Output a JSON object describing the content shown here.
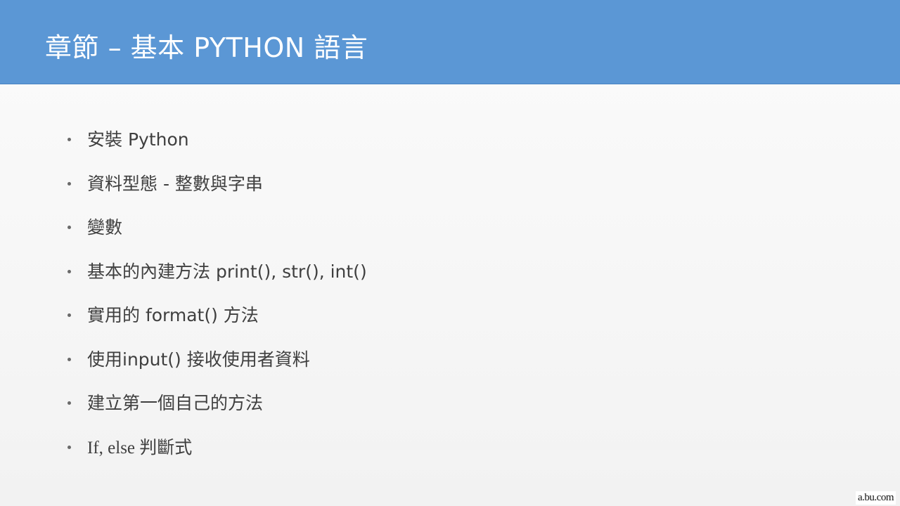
{
  "slide": {
    "title": "章節 – 基本 PYTHON 語言",
    "bullets": [
      "安裝 Python",
      "資料型態 - 整數與字串",
      "變數",
      "基本的內建方法 print(), str(), int()",
      "實用的 format() 方法",
      "使用input() 接收使用者資料",
      "建立第一個自己的方法",
      "If, else 判斷式"
    ],
    "watermark": "a.bu.com"
  },
  "colors": {
    "header_bg": "#5b97d5",
    "title_text": "#ffffff",
    "body_text": "#3f3f3f"
  }
}
